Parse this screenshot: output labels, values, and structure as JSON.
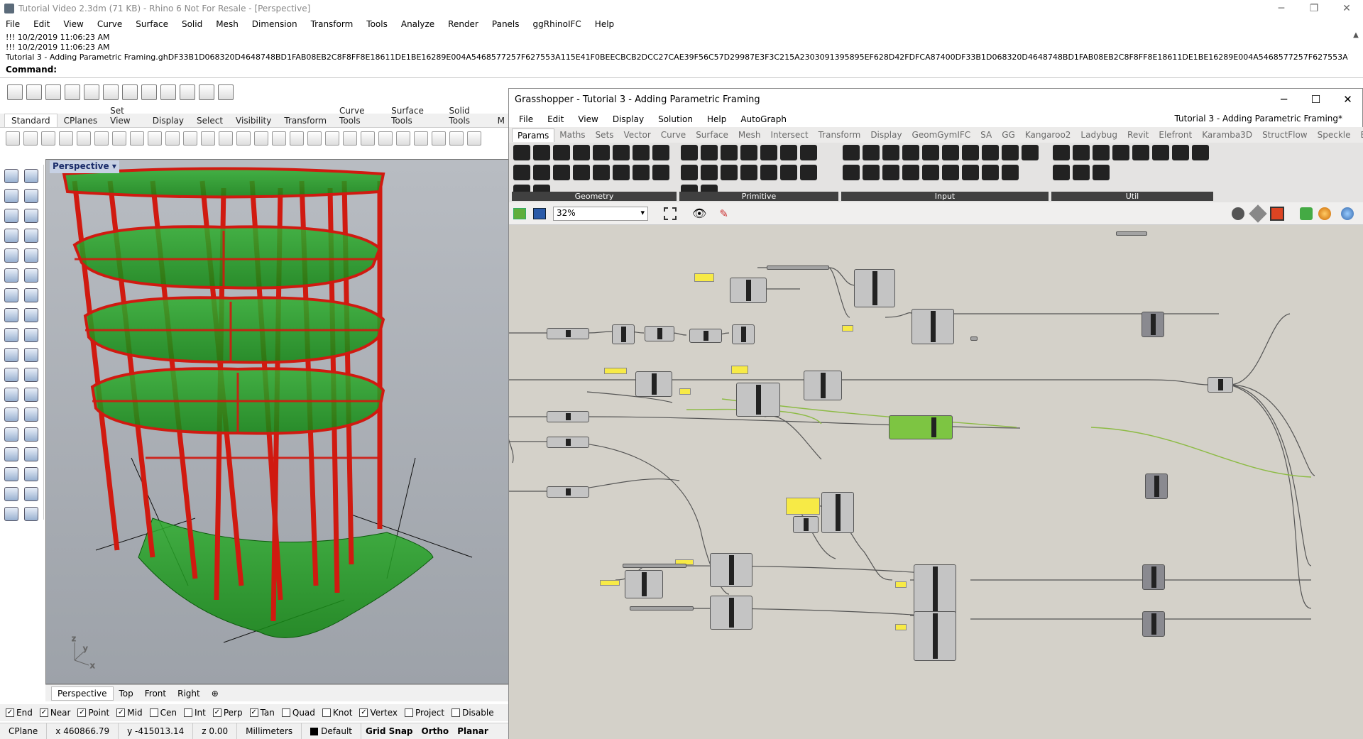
{
  "rhino": {
    "title": "Tutorial Video 2.3dm (71 KB) - Rhino 6 Not For Resale - [Perspective]",
    "menu": [
      "File",
      "Edit",
      "View",
      "Curve",
      "Surface",
      "Solid",
      "Mesh",
      "Dimension",
      "Transform",
      "Tools",
      "Analyze",
      "Render",
      "Panels",
      "ggRhinoIFC",
      "Help"
    ],
    "history": [
      "!!! 10/2/2019 11:06:23 AM",
      "!!! 10/2/2019 11:06:23 AM",
      "Tutorial 3 - Adding Parametric Framing.ghDF33B1D068320D4648748BD1FAB08EB2C8F8FF8E18611DE1BE16289E004A5468577257F627553A115E41F0BEECBCB2DCC27CAE39F56C57D29987E3F3C215A2303091395895EF628D42FDFCA87400DF33B1D068320D4648748BD1FAB08EB2C8F8FF8E18611DE1BE16289E004A5468577257F627553A115E41F0BEECBCB2DCC27CAE39F56C5"
    ],
    "command_label": "Command:",
    "toolbar_tabs": [
      "Standard",
      "CPlanes",
      "Set View",
      "Display",
      "Select",
      "Visibility",
      "Transform",
      "Curve Tools",
      "Surface Tools",
      "Solid Tools",
      "M"
    ],
    "viewport_label": "Perspective",
    "view_tabs": [
      "Perspective",
      "Top",
      "Front",
      "Right"
    ],
    "osnaps": [
      {
        "label": "End",
        "checked": true
      },
      {
        "label": "Near",
        "checked": true
      },
      {
        "label": "Point",
        "checked": true
      },
      {
        "label": "Mid",
        "checked": true
      },
      {
        "label": "Cen",
        "checked": false
      },
      {
        "label": "Int",
        "checked": false
      },
      {
        "label": "Perp",
        "checked": true
      },
      {
        "label": "Tan",
        "checked": true
      },
      {
        "label": "Quad",
        "checked": false
      },
      {
        "label": "Knot",
        "checked": false
      },
      {
        "label": "Vertex",
        "checked": true
      },
      {
        "label": "Project",
        "checked": false
      },
      {
        "label": "Disable",
        "checked": false
      }
    ],
    "status": {
      "cplane": "CPlane",
      "x": "x 460866.79",
      "y": "y -415013.14",
      "z": "z 0.00",
      "units": "Millimeters",
      "layer": "Default",
      "grid_snap": "Grid Snap",
      "ortho": "Ortho",
      "planar": "Planar"
    },
    "axis": {
      "x": "x",
      "y": "y",
      "z": "z"
    }
  },
  "grasshopper": {
    "title": "Grasshopper - Tutorial 3 - Adding Parametric Framing",
    "menu": [
      "File",
      "Edit",
      "View",
      "Display",
      "Solution",
      "Help",
      "AutoGraph"
    ],
    "doc_title": "Tutorial 3 - Adding Parametric Framing*",
    "tabs": [
      "Params",
      "Maths",
      "Sets",
      "Vector",
      "Curve",
      "Surface",
      "Mesh",
      "Intersect",
      "Transform",
      "Display",
      "GeomGymIFC",
      "SA",
      "GG",
      "Kangaroo2",
      "Ladybug",
      "Revit",
      "Elefront",
      "Karamba3D",
      "StructFlow",
      "Speckle",
      "Bumblebee"
    ],
    "groups": [
      {
        "label": "Geometry",
        "count": 18
      },
      {
        "label": "Primitive",
        "count": 16
      },
      {
        "label": "Input",
        "count": 19
      },
      {
        "label": "Util",
        "count": 11
      }
    ],
    "zoom": "32%"
  },
  "colors": {
    "panel_yellow": "#f7ea46",
    "floor_green": "#1e9a1e",
    "frame_red": "#d01a10",
    "component_grey": "#c4c4c4",
    "canvas_bg": "#d4d1c9",
    "active_green": "#7dc542"
  }
}
